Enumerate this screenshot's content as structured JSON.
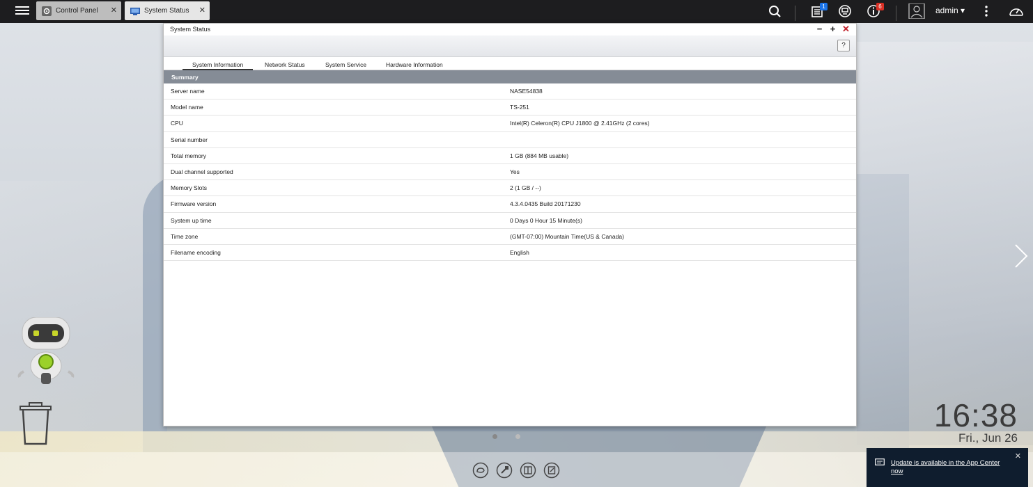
{
  "taskbar": {
    "tabs": [
      {
        "label": "Control Panel"
      },
      {
        "label": "System Status"
      }
    ],
    "badges": {
      "tasks": "1",
      "notifications": "6"
    },
    "user": "admin"
  },
  "window": {
    "title": "System Status",
    "help": "?",
    "tabs": [
      "System Information",
      "Network Status",
      "System Service",
      "Hardware Information"
    ],
    "section": "Summary",
    "rows": [
      {
        "label": "Server name",
        "value": "NASE54838"
      },
      {
        "label": "Model name",
        "value": "TS-251"
      },
      {
        "label": "CPU",
        "value": "Intel(R) Celeron(R) CPU J1800 @ 2.41GHz (2 cores)"
      },
      {
        "label": "Serial number",
        "value": ""
      },
      {
        "label": "Total memory",
        "value": "1 GB (884 MB usable)"
      },
      {
        "label": "Dual channel supported",
        "value": "Yes"
      },
      {
        "label": "Memory Slots",
        "value": "2 (1 GB / --)"
      },
      {
        "label": "Firmware version",
        "value": "4.3.4.0435 Build 20171230"
      },
      {
        "label": "System up time",
        "value": "0 Days 0 Hour 15 Minute(s)"
      },
      {
        "label": "Time zone",
        "value": "(GMT-07:00) Mountain Time(US & Canada)"
      },
      {
        "label": "Filename encoding",
        "value": "English"
      }
    ]
  },
  "clock": {
    "time": "16:38",
    "date": "Fri., Jun 26"
  },
  "notification": {
    "text": "Update is available in the App Center now"
  },
  "colors": {
    "topbar": "#1d1d1f",
    "badge_blue": "#1a73e8",
    "badge_red": "#d93025",
    "close_red": "#c0202a",
    "summary_bar": "#858c96"
  }
}
